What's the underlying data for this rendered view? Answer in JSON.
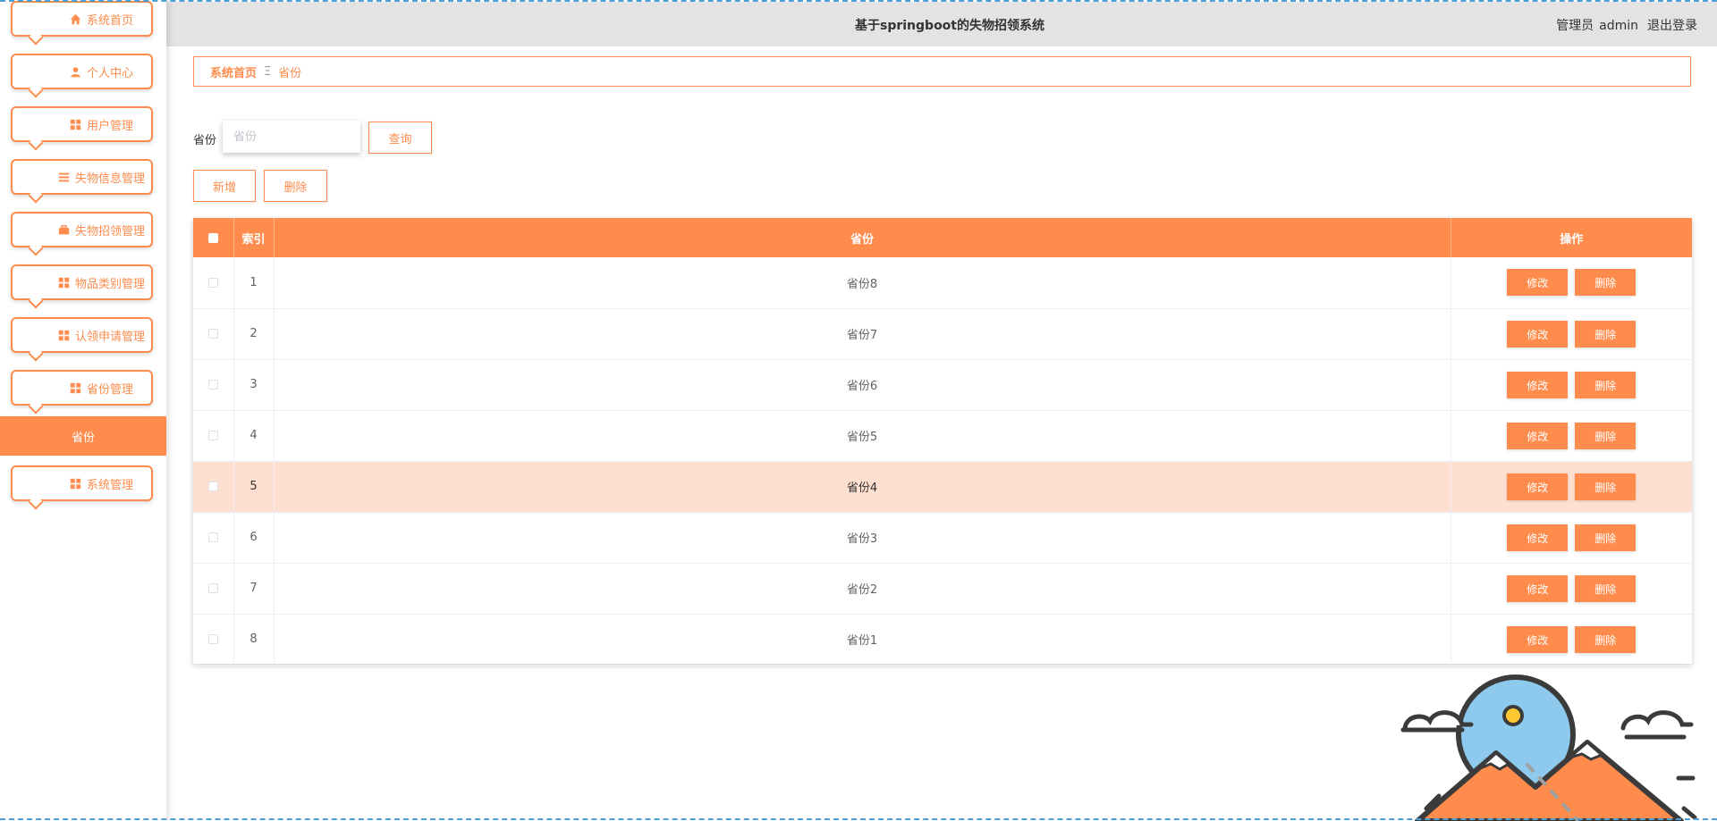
{
  "app_title": "基于springboot的失物招领系统",
  "user": {
    "role": "管理员",
    "name": "admin",
    "logout": "退出登录"
  },
  "sidebar": {
    "items": [
      {
        "label": "系统首页",
        "icon": "home-icon"
      },
      {
        "label": "个人中心",
        "icon": "user-icon"
      },
      {
        "label": "用户管理",
        "icon": "grid-icon"
      },
      {
        "label": "失物信息管理",
        "icon": "list-icon"
      },
      {
        "label": "失物招领管理",
        "icon": "briefcase-icon"
      },
      {
        "label": "物品类别管理",
        "icon": "grid-icon"
      },
      {
        "label": "认领申请管理",
        "icon": "grid-icon"
      },
      {
        "label": "省份管理",
        "icon": "grid-icon"
      },
      {
        "label": "系统管理",
        "icon": "grid-icon"
      }
    ],
    "active_sub": "省份"
  },
  "breadcrumb": {
    "home": "系统首页",
    "separator": "Ξ",
    "current": "省份"
  },
  "search": {
    "label": "省份",
    "placeholder": "省份",
    "value": "",
    "query_button": "查询"
  },
  "actions": {
    "add": "新增",
    "delete": "删除"
  },
  "table": {
    "columns": [
      "索引",
      "省份",
      "操作"
    ],
    "edit_label": "修改",
    "delete_label": "删除",
    "rows": [
      {
        "index": "1",
        "province": "省份8"
      },
      {
        "index": "2",
        "province": "省份7"
      },
      {
        "index": "3",
        "province": "省份6"
      },
      {
        "index": "4",
        "province": "省份5"
      },
      {
        "index": "5",
        "province": "省份4"
      },
      {
        "index": "6",
        "province": "省份3"
      },
      {
        "index": "7",
        "province": "省份2"
      },
      {
        "index": "8",
        "province": "省份1"
      }
    ],
    "highlighted_row": 5
  },
  "colors": {
    "accent": "#ff8c4d",
    "header_bg": "#e4e3e4",
    "row_highlight": "#ffdfcf"
  }
}
